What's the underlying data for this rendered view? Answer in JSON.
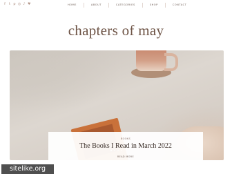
{
  "social_icons": [
    "facebook-icon",
    "twitter-icon",
    "pinterest-icon",
    "instagram-icon",
    "tiktok-icon",
    "heart-icon"
  ],
  "nav": {
    "items": [
      "HOME",
      "ABOUT",
      "CATEGORIES",
      "SHOP",
      "CONTACT"
    ]
  },
  "site": {
    "title": "chapters of may"
  },
  "slider": {
    "category": "BOOKS",
    "post_title": "The Books I Read in March 2022",
    "read_more": "READ MORE",
    "dot_count": 4,
    "active_dot": 1
  },
  "watermark": "sitelike.org",
  "colors": {
    "title": "#6e5446",
    "nav_text": "#6b5a52",
    "social_icon": "#b3968a"
  }
}
